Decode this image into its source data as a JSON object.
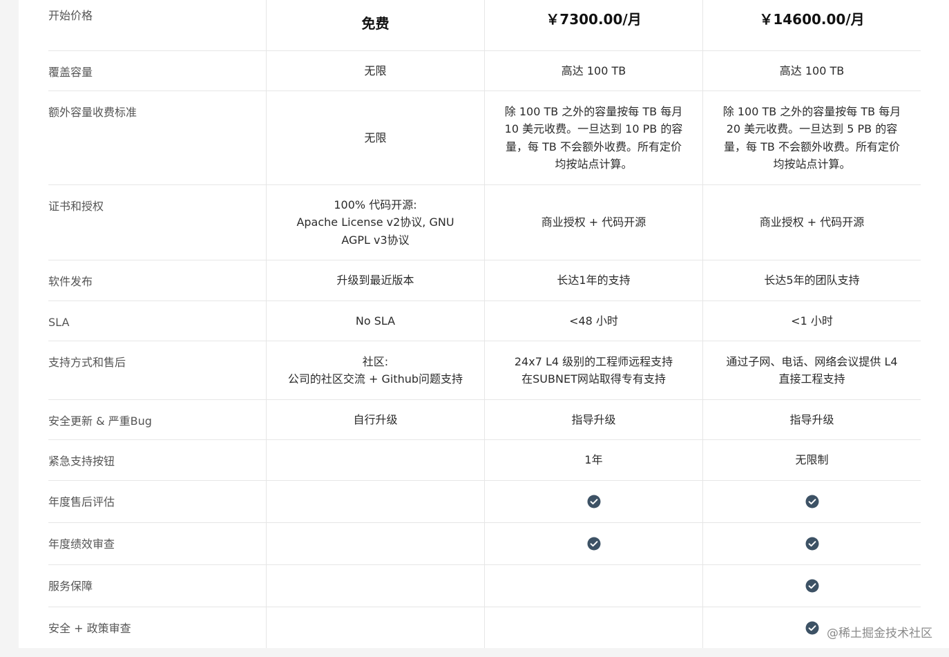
{
  "table": {
    "rows": [
      {
        "label": "开始价格",
        "c1": "免费",
        "c2": "￥7300.00/月",
        "c3": "￥14600.00/月"
      },
      {
        "label": "覆盖容量",
        "c1": "无限",
        "c2": "高达 100 TB",
        "c3": "高达 100 TB"
      },
      {
        "label": "额外容量收费标准",
        "c1": "无限",
        "c2": "除 100 TB 之外的容量按每 TB 每月\n10 美元收费。一旦达到 10 PB 的容\n量，每 TB 不会额外收费。所有定价\n均按站点计算。",
        "c3": "除 100 TB 之外的容量按每 TB 每月\n20 美元收费。一旦达到 5 PB 的容\n量，每 TB 不会额外收费。所有定价\n均按站点计算。"
      },
      {
        "label": "证书和授权",
        "c1": "100% 代码开源:\nApache License v2协议, GNU\nAGPL v3协议",
        "c2": "商业授权 + 代码开源",
        "c3": "商业授权 + 代码开源"
      },
      {
        "label": "软件发布",
        "c1": "升级到最近版本",
        "c2": "长达1年的支持",
        "c3": "长达5年的团队支持"
      },
      {
        "label": "SLA",
        "c1": "No SLA",
        "c2": "<48 小时",
        "c3": "<1 小时"
      },
      {
        "label": "支持方式和售后",
        "c1": "社区:\n公司的社区交流 + Github问题支持",
        "c2": "24x7 L4 级别的工程师远程支持\n在SUBNET网站取得专有支持",
        "c3": "通过子网、电话、网络会议提供 L4\n直接工程支持"
      },
      {
        "label": "安全更新 & 严重Bug",
        "c1": "自行升级",
        "c2": "指导升级",
        "c3": "指导升级"
      },
      {
        "label": "紧急支持按钮",
        "c1": "",
        "c2": "1年",
        "c3": "无限制"
      },
      {
        "label": "年度售后评估",
        "c1": "",
        "c2": "",
        "c3": ""
      },
      {
        "label": "年度绩效审查",
        "c1": "",
        "c2": "",
        "c3": ""
      },
      {
        "label": "服务保障",
        "c1": "",
        "c2": "",
        "c3": ""
      },
      {
        "label": "安全 + 政策审查",
        "c1": "",
        "c2": "",
        "c3": ""
      }
    ],
    "checks": [
      {
        "row": 9,
        "c1": false,
        "c2": true,
        "c3": true
      },
      {
        "row": 10,
        "c1": false,
        "c2": true,
        "c3": true
      },
      {
        "row": 11,
        "c1": false,
        "c2": false,
        "c3": true
      },
      {
        "row": 12,
        "c1": false,
        "c2": false,
        "c3": true
      }
    ]
  },
  "watermark": "@稀土掘金技术社区",
  "colors": {
    "check": "#3d5265",
    "border": "#e6e6e6"
  },
  "icons": {
    "check": "check-circle-icon"
  }
}
